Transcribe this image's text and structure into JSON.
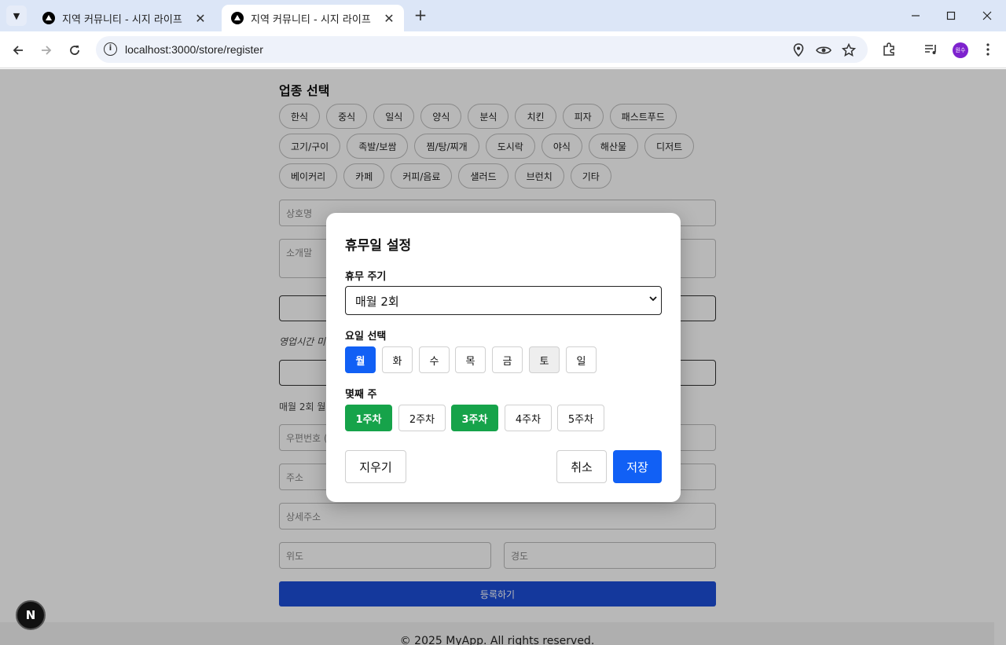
{
  "browser": {
    "tabs": [
      {
        "title": "지역 커뮤니티 - 시지 라이프",
        "active": false
      },
      {
        "title": "지역 커뮤니티 - 시지 라이프",
        "active": true
      }
    ],
    "url": "localhost:3000/store/register",
    "profile_initials": "원수"
  },
  "page": {
    "category_heading": "업종 선택",
    "categories": [
      "한식",
      "중식",
      "일식",
      "양식",
      "분식",
      "치킨",
      "피자",
      "패스트푸드",
      "고기/구이",
      "족발/보쌈",
      "찜/탕/찌개",
      "도시락",
      "야식",
      "해산물",
      "디저트",
      "베이커리",
      "카페",
      "커피/음료",
      "샐러드",
      "브런치",
      "기타"
    ],
    "store_name_placeholder": "상호명",
    "intro_placeholder": "소개말",
    "hours_hint": "영업시간 미",
    "closed_summary": "매월 2회 월",
    "zipcode_placeholder": "우편번호 (",
    "address_placeholder": "주소",
    "detail_address_placeholder": "상세주소",
    "latitude_placeholder": "위도",
    "longitude_placeholder": "경도",
    "submit_label": "등록하기",
    "footer": "© 2025 MyApp. All rights reserved."
  },
  "modal": {
    "title": "휴무일 설정",
    "cycle_label": "휴무 주기",
    "cycle_value": "매월 2회",
    "day_label": "요일 선택",
    "days": [
      {
        "label": "월",
        "selected": true
      },
      {
        "label": "화",
        "selected": false
      },
      {
        "label": "수",
        "selected": false
      },
      {
        "label": "목",
        "selected": false
      },
      {
        "label": "금",
        "selected": false
      },
      {
        "label": "토",
        "selected": false
      },
      {
        "label": "일",
        "selected": false
      }
    ],
    "week_label": "몇째 주",
    "weeks": [
      {
        "label": "1주차",
        "selected": true
      },
      {
        "label": "2주차",
        "selected": false
      },
      {
        "label": "3주차",
        "selected": true
      },
      {
        "label": "4주차",
        "selected": false
      },
      {
        "label": "5주차",
        "selected": false
      }
    ],
    "clear_label": "지우기",
    "cancel_label": "취소",
    "save_label": "저장"
  },
  "colors": {
    "primary": "#1160f5",
    "week_selected": "#16a34a",
    "submit": "#1d4ed8",
    "avatar": "#7e22ce"
  },
  "next_badge": "N"
}
